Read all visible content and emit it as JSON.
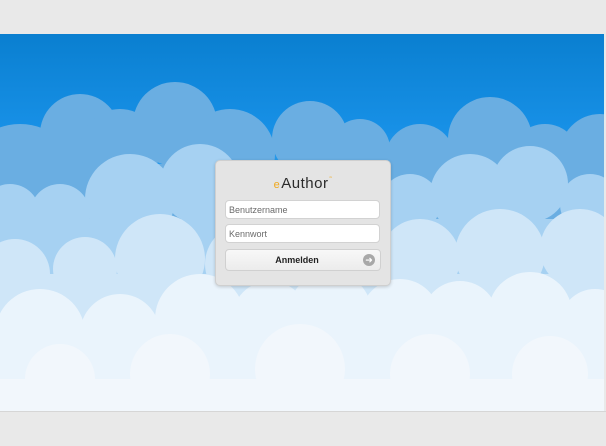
{
  "app": {
    "logo_text": "Author",
    "logo_mark": "e",
    "logo_suffix": "˜"
  },
  "login": {
    "username_placeholder": "Benutzername",
    "password_placeholder": "Kennwort",
    "submit_label": "Anmelden",
    "submit_icon": "arrow-circle-right-icon"
  },
  "colors": {
    "sky_top": "#0a7fd0",
    "sky_mid": "#3aa5f0",
    "accent": "#f0a91e"
  }
}
